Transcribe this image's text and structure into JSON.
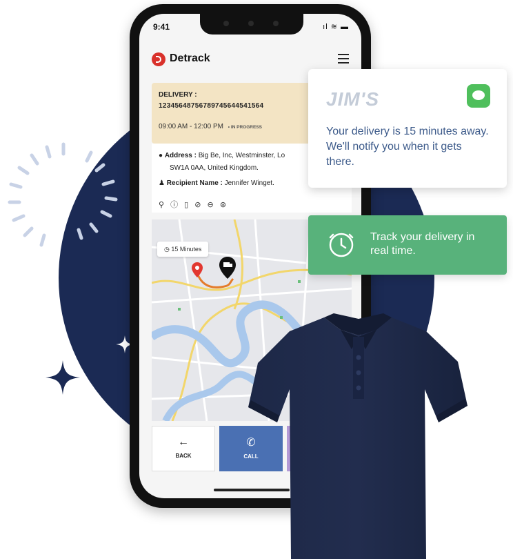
{
  "phone": {
    "status_time": "9:41",
    "status_icons": "ıl ≋ ▬",
    "brand": "Detrack",
    "delivery": {
      "title": "DELIVERY :",
      "number": "12345648756789745644541564",
      "time": "09:00 AM - 12:00 PM",
      "status": "• IN PROGRESS"
    },
    "address_label": "Address :",
    "address_value": "Big Be, Inc, Westminster, Lo",
    "address_line2": "SW1A 0AA, United Kingdom.",
    "recipient_label": "Recipient Name :",
    "recipient_value": "Jennifer Winget.",
    "action_icons": "⚲ ⓘ ▯ ⊘ ⊖ ⊛",
    "map_eta": "15 Minutes",
    "buttons": {
      "back": "BACK",
      "back_glyph": "←",
      "call": "CALL",
      "call_glyph": "✆"
    }
  },
  "notification": {
    "logo": "JIM'S",
    "message": "Your delivery is 15 minutes away. We'll notify you when it gets there."
  },
  "track": {
    "message": "Track your delivery in real time."
  },
  "colors": {
    "background_circle": "#1b2a54",
    "notification_text": "#3c5a8a",
    "track_banner": "#58b27b",
    "call_button": "#4a70b3",
    "delivery_card": "#f3e4c4",
    "shirt": "#1a2440"
  }
}
